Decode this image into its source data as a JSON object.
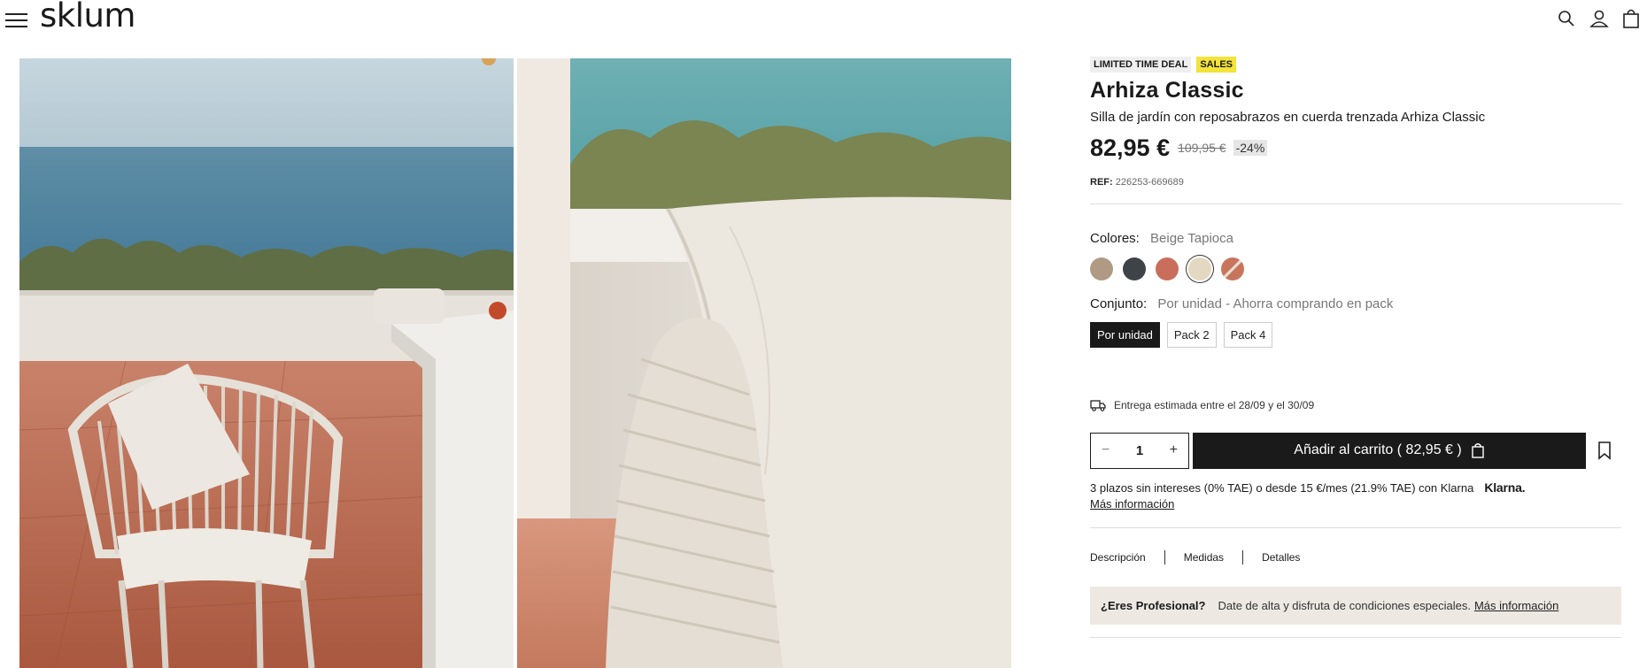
{
  "header": {
    "logo": "sklum",
    "icons": [
      "menu-icon",
      "search-icon",
      "user-icon",
      "bag-icon"
    ]
  },
  "product": {
    "badges": {
      "deal": "LIMITED TIME DEAL",
      "sales": "SALES"
    },
    "title": "Arhiza Classic",
    "subtitle": "Silla de jardín con reposabrazos en cuerda trenzada Arhiza Classic",
    "price": "82,95 €",
    "old_price": "109,95 €",
    "discount": "-24%",
    "ref_label": "REF:",
    "ref_value": "226253-669689",
    "colors_label": "Colores:",
    "colors_selected": "Beige Tapioca",
    "swatches": [
      {
        "name": "taupe",
        "color": "#b09a84"
      },
      {
        "name": "dark-grey",
        "color": "#3e4347"
      },
      {
        "name": "terracotta",
        "color": "#c96e5b"
      },
      {
        "name": "beige-tapioca",
        "color": "#e4d8c2"
      },
      {
        "name": "terracotta-beige",
        "color": "#c9755e"
      }
    ],
    "pack_label": "Conjunto:",
    "pack_selected": "Por unidad - Ahorra comprando en pack",
    "pack_options": [
      "Por unidad",
      "Pack 2",
      "Pack 4"
    ],
    "delivery": "Entrega estimada entre el 28/09 y el 30/09",
    "quantity": "1",
    "qty_minus": "−",
    "qty_plus": "+",
    "add_to_cart": "Añadir al carrito ( 82,95 € )",
    "klarna_text": "3 plazos sin intereses (0% TAE) o desde 15 €/mes (21.9% TAE) con Klarna",
    "klarna_logo": "Klarna.",
    "more_info": "Más información",
    "tabs": [
      "Descripción",
      "Medidas",
      "Detalles"
    ],
    "pro_title": "¿Eres Profesional?",
    "pro_text": "Date de alta y disfruta de condiciones especiales.",
    "pro_link": "Más información"
  }
}
